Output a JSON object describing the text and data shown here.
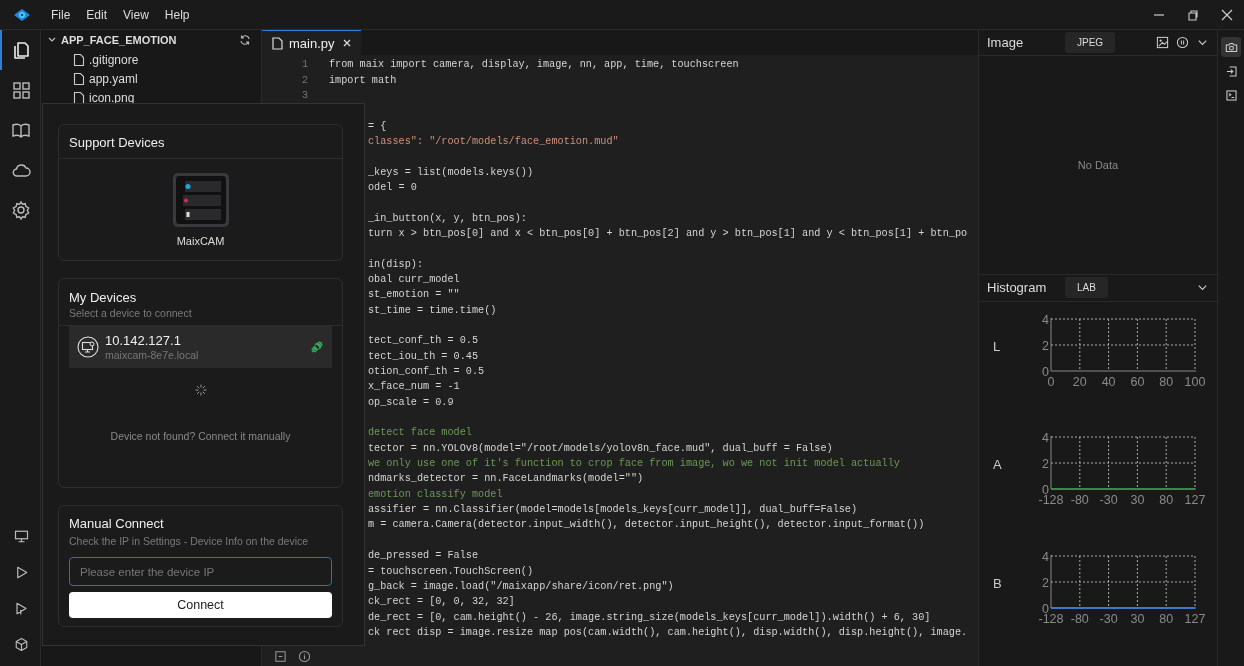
{
  "menus": [
    "File",
    "Edit",
    "View",
    "Help"
  ],
  "activity_bar": {
    "top": [
      {
        "kind": "files",
        "selected": true
      },
      {
        "kind": "grid",
        "selected": false
      },
      {
        "kind": "book",
        "selected": false
      },
      {
        "kind": "cloud",
        "selected": false
      },
      {
        "kind": "settings",
        "selected": false
      }
    ],
    "bottom": [
      {
        "kind": "monitor",
        "selected": false
      },
      {
        "kind": "run",
        "selected": false
      },
      {
        "kind": "run-all",
        "selected": false
      },
      {
        "kind": "package",
        "selected": false
      }
    ]
  },
  "explorer": {
    "title": "APP_FACE_EMOTION",
    "expanded": true,
    "files": [
      ".gitignore",
      "app.yaml",
      "icon.png"
    ]
  },
  "editor": {
    "tabs": [
      {
        "label": "main.py",
        "selected": true
      }
    ],
    "lines": [
      {
        "number": "1",
        "kind": "code",
        "text": "from maix import camera, display, image, nn, app, time, touchscreen"
      },
      {
        "number": "2",
        "kind": "code",
        "text": "import math"
      },
      {
        "number": "3",
        "kind": "blank"
      },
      {
        "kind": "blank"
      },
      {
        "kind": "code",
        "text": "= {"
      },
      {
        "kind": "string",
        "text": "classes\": \"/root/models/face_emotion.mud\""
      },
      {
        "kind": "blank"
      },
      {
        "kind": "code",
        "text": "_keys = list(models.keys())"
      },
      {
        "kind": "code",
        "text": "odel = 0"
      },
      {
        "kind": "blank"
      },
      {
        "kind": "code",
        "text": "_in_button(x, y, btn_pos):"
      },
      {
        "kind": "code",
        "text": "turn x > btn_pos[0] and x < btn_pos[0] + btn_pos[2] and y > btn_pos[1] and y < btn_pos[1] + btn_po"
      },
      {
        "kind": "blank"
      },
      {
        "kind": "code",
        "text": "in(disp):"
      },
      {
        "kind": "code",
        "text": "obal curr_model"
      },
      {
        "kind": "code",
        "text": "st_emotion = \"\""
      },
      {
        "kind": "code",
        "text": "st_time = time.time()"
      },
      {
        "kind": "blank"
      },
      {
        "kind": "code",
        "text": "tect_conf_th = 0.5"
      },
      {
        "kind": "code",
        "text": "tect_iou_th = 0.45"
      },
      {
        "kind": "code",
        "text": "otion_conf_th = 0.5"
      },
      {
        "kind": "code",
        "text": "x_face_num = -1"
      },
      {
        "kind": "code",
        "text": "op_scale = 0.9"
      },
      {
        "kind": "blank"
      },
      {
        "kind": "comment",
        "text": "detect face model"
      },
      {
        "kind": "code",
        "text": "tector = nn.YOLOv8(model=\"/root/models/yolov8n_face.mud\", dual_buff = False)"
      },
      {
        "kind": "comment",
        "text": "we only use one of it's function to crop face from image, wo we not init model actually"
      },
      {
        "kind": "code",
        "text": "ndmarks_detector = nn.FaceLandmarks(model=\"\")"
      },
      {
        "kind": "comment",
        "text": "emotion classify model"
      },
      {
        "kind": "code",
        "text": "assifier = nn.Classifier(model=models[models_keys[curr_model]], dual_buff=False)"
      },
      {
        "kind": "code",
        "text": "m = camera.Camera(detector.input_width(), detector.input_height(), detector.input_format())"
      },
      {
        "kind": "blank"
      },
      {
        "kind": "code",
        "text": "de_pressed = False"
      },
      {
        "kind": "code",
        "text": "= touchscreen.TouchScreen()"
      },
      {
        "kind": "code",
        "text": "g_back = image.load(\"/maixapp/share/icon/ret.png\")"
      },
      {
        "kind": "code",
        "text": "ck_rect = [0, 0, 32, 32]"
      },
      {
        "kind": "code",
        "text": "de_rect = [0, cam.height() - 26, image.string_size(models_keys[curr_model]).width() + 6, 30]"
      },
      {
        "kind": "code",
        "text": "ck rect disp = image.resize map pos(cam.width(), cam.height(), disp.width(), disp.height(), image."
      }
    ]
  },
  "image_panel": {
    "title": "Image",
    "format": "JPEG",
    "empty_text": "No Data"
  },
  "histogram": {
    "title": "Histogram",
    "mode": "LAB",
    "channels": [
      {
        "chart_data": {
          "type": "line",
          "title": "L",
          "grid": true,
          "xlim": [
            0,
            100
          ],
          "ylim": [
            0,
            4
          ],
          "xticks": [
            0,
            20,
            40,
            60,
            80,
            100
          ],
          "yticks": [
            0,
            2,
            4
          ]
        }
      },
      {
        "chart_data": {
          "type": "line",
          "title": "A",
          "grid": true,
          "categories": [
            "-128",
            "-80",
            "-30",
            "30",
            "80",
            "127"
          ],
          "ylim": [
            0,
            4
          ],
          "yticks": [
            0,
            2,
            4
          ],
          "series": [
            {
              "color": "#2ea043",
              "values": [
                0,
                0,
                0,
                0,
                0,
                0
              ]
            }
          ]
        }
      },
      {
        "chart_data": {
          "type": "line",
          "title": "B",
          "grid": true,
          "categories": [
            "-128",
            "-80",
            "-30",
            "30",
            "80",
            "127"
          ],
          "ylim": [
            0,
            4
          ],
          "yticks": [
            0,
            2,
            4
          ],
          "series": [
            {
              "color": "#3b82f6",
              "values": [
                0,
                0,
                0,
                0,
                0,
                0
              ]
            }
          ]
        }
      }
    ]
  },
  "side_tools": [
    {
      "kind": "camera",
      "selected": true
    },
    {
      "kind": "import",
      "selected": false
    },
    {
      "kind": "terminal",
      "selected": false
    }
  ],
  "device_popup": {
    "support": {
      "title": "Support Devices",
      "devices": [
        {
          "name": "MaixCAM"
        }
      ]
    },
    "my_devices": {
      "title": "My Devices",
      "subtitle": "Select a device to connect",
      "devices": [
        {
          "ip": "10.142.127.1",
          "host": "maixcam-8e7e.local",
          "connected": true
        }
      ],
      "loading": true,
      "hint": "Device not found? Connect it manually"
    },
    "manual": {
      "title": "Manual Connect",
      "subtitle": "Check the IP in Settings - Device Info on the device",
      "placeholder": "Please enter the device IP",
      "button": "Connect"
    }
  }
}
